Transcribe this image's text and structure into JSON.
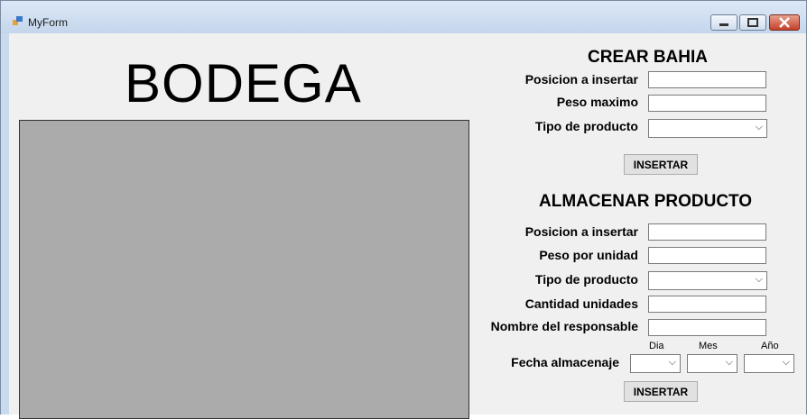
{
  "window": {
    "title": "MyForm"
  },
  "main": {
    "heading": "BODEGA"
  },
  "crear_bahia": {
    "title": "CREAR BAHIA",
    "labels": [
      "Posicion a insertar",
      "Peso maximo",
      "Tipo de producto"
    ],
    "inputs": [
      "",
      ""
    ],
    "tipo_selected": "",
    "button": "INSERTAR"
  },
  "almacenar": {
    "title": "ALMACENAR PRODUCTO",
    "labels": [
      "Posicion a insertar",
      "Peso por unidad",
      "Tipo de producto",
      "Cantidad unidades",
      "Nombre del responsable"
    ],
    "inputs": [
      "",
      "",
      "",
      ""
    ],
    "tipo_selected": "",
    "fecha_label": "Fecha almacenaje",
    "fecha_sublabels": [
      "Dia",
      "Mes",
      "Año"
    ],
    "fecha_values": [
      "",
      "",
      ""
    ],
    "button": "INSERTAR"
  },
  "icons": {
    "dropdown": "chevron-down-icon",
    "minimize": "minimize-icon",
    "maximize": "maximize-icon",
    "close": "close-icon",
    "app": "app-icon"
  }
}
